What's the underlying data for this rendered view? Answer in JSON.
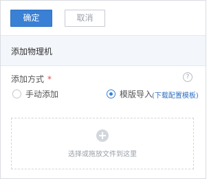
{
  "toolbar": {
    "confirm_label": "确定",
    "cancel_label": "取消"
  },
  "section": {
    "title": "添加物理机"
  },
  "form": {
    "method_label": "添加方式",
    "required_mark": "*",
    "help_symbol": "?",
    "options": [
      {
        "label": "手动添加",
        "selected": false
      },
      {
        "label": "模版导入",
        "selected": true
      }
    ],
    "download_link": "(下载配置模板)",
    "dropzone_text": "选择或拖放文件到这里"
  },
  "colors": {
    "primary": "#3a80d5",
    "header_bg": "#f3f6fa",
    "link": "#2f6fc2",
    "required": "#e04a4a"
  }
}
